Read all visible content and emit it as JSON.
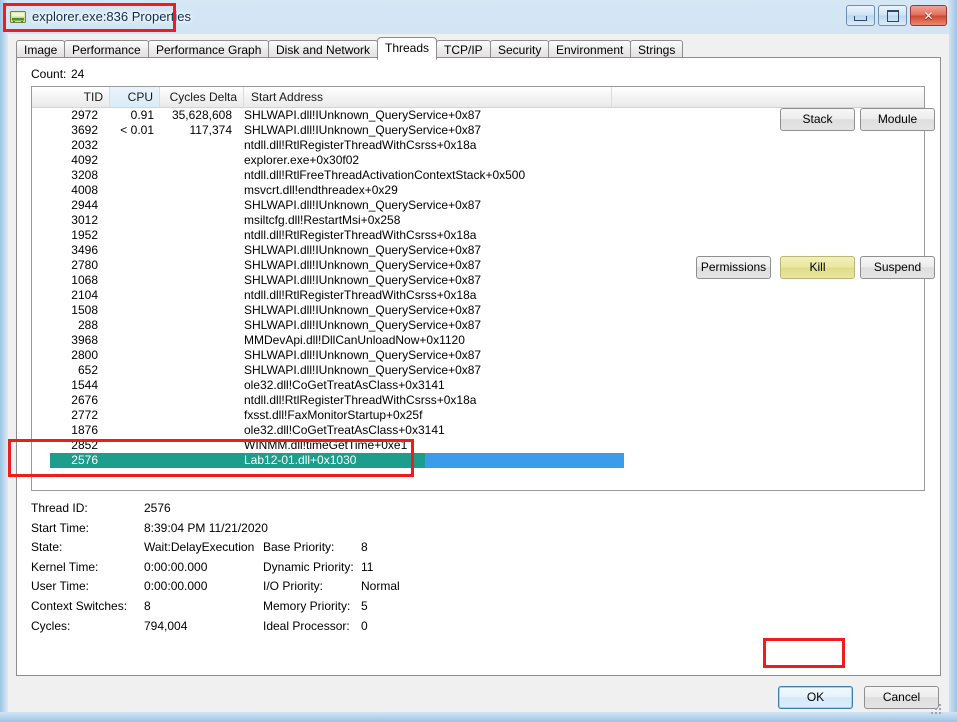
{
  "window": {
    "title": "explorer.exe:836 Properties",
    "icon": "process-explorer-icon",
    "minimize_label": "Minimize",
    "maximize_label": "Maximize",
    "close_label": "Close"
  },
  "tabs": [
    {
      "label": "Image",
      "active": false
    },
    {
      "label": "Performance",
      "active": false
    },
    {
      "label": "Performance Graph",
      "active": false
    },
    {
      "label": "Disk and Network",
      "active": false
    },
    {
      "label": "Threads",
      "active": true
    },
    {
      "label": "TCP/IP",
      "active": false
    },
    {
      "label": "Security",
      "active": false
    },
    {
      "label": "Environment",
      "active": false
    },
    {
      "label": "Strings",
      "active": false
    }
  ],
  "threads": {
    "count_label": "Count:",
    "count_value": "24",
    "columns": [
      {
        "key": "tid",
        "label": "TID",
        "sorted": false
      },
      {
        "key": "cpu",
        "label": "CPU",
        "sorted": true
      },
      {
        "key": "cyc",
        "label": "Cycles Delta",
        "sorted": false
      },
      {
        "key": "addr",
        "label": "Start Address",
        "sorted": false
      }
    ],
    "sort_direction": "descending",
    "rows": [
      {
        "tid": "2972",
        "cpu": "0.91",
        "cyc": "35,628,608",
        "addr": "SHLWAPI.dll!IUnknown_QueryService+0x87"
      },
      {
        "tid": "3692",
        "cpu": "< 0.01",
        "cyc": "117,374",
        "addr": "SHLWAPI.dll!IUnknown_QueryService+0x87"
      },
      {
        "tid": "2032",
        "cpu": "",
        "cyc": "",
        "addr": "ntdll.dll!RtlRegisterThreadWithCsrss+0x18a"
      },
      {
        "tid": "4092",
        "cpu": "",
        "cyc": "",
        "addr": "explorer.exe+0x30f02"
      },
      {
        "tid": "3208",
        "cpu": "",
        "cyc": "",
        "addr": "ntdll.dll!RtlFreeThreadActivationContextStack+0x500"
      },
      {
        "tid": "4008",
        "cpu": "",
        "cyc": "",
        "addr": "msvcrt.dll!endthreadex+0x29"
      },
      {
        "tid": "2944",
        "cpu": "",
        "cyc": "",
        "addr": "SHLWAPI.dll!IUnknown_QueryService+0x87"
      },
      {
        "tid": "3012",
        "cpu": "",
        "cyc": "",
        "addr": "msiltcfg.dll!RestartMsi+0x258"
      },
      {
        "tid": "1952",
        "cpu": "",
        "cyc": "",
        "addr": "ntdll.dll!RtlRegisterThreadWithCsrss+0x18a"
      },
      {
        "tid": "3496",
        "cpu": "",
        "cyc": "",
        "addr": "SHLWAPI.dll!IUnknown_QueryService+0x87"
      },
      {
        "tid": "2780",
        "cpu": "",
        "cyc": "",
        "addr": "SHLWAPI.dll!IUnknown_QueryService+0x87"
      },
      {
        "tid": "1068",
        "cpu": "",
        "cyc": "",
        "addr": "SHLWAPI.dll!IUnknown_QueryService+0x87"
      },
      {
        "tid": "2104",
        "cpu": "",
        "cyc": "",
        "addr": "ntdll.dll!RtlRegisterThreadWithCsrss+0x18a"
      },
      {
        "tid": "1508",
        "cpu": "",
        "cyc": "",
        "addr": "SHLWAPI.dll!IUnknown_QueryService+0x87"
      },
      {
        "tid": "288",
        "cpu": "",
        "cyc": "",
        "addr": "SHLWAPI.dll!IUnknown_QueryService+0x87"
      },
      {
        "tid": "3968",
        "cpu": "",
        "cyc": "",
        "addr": "MMDevApi.dll!DllCanUnloadNow+0x1120"
      },
      {
        "tid": "2800",
        "cpu": "",
        "cyc": "",
        "addr": "SHLWAPI.dll!IUnknown_QueryService+0x87"
      },
      {
        "tid": "652",
        "cpu": "",
        "cyc": "",
        "addr": "SHLWAPI.dll!IUnknown_QueryService+0x87"
      },
      {
        "tid": "1544",
        "cpu": "",
        "cyc": "",
        "addr": "ole32.dll!CoGetTreatAsClass+0x3141"
      },
      {
        "tid": "2676",
        "cpu": "",
        "cyc": "",
        "addr": "ntdll.dll!RtlRegisterThreadWithCsrss+0x18a"
      },
      {
        "tid": "2772",
        "cpu": "",
        "cyc": "",
        "addr": "fxsst.dll!FaxMonitorStartup+0x25f"
      },
      {
        "tid": "1876",
        "cpu": "",
        "cyc": "",
        "addr": "ole32.dll!CoGetTreatAsClass+0x3141"
      },
      {
        "tid": "2852",
        "cpu": "",
        "cyc": "",
        "addr": "WINMM.dll!timeGetTime+0xe1"
      },
      {
        "tid": "2576",
        "cpu": "",
        "cyc": "",
        "addr": "Lab12-01.dll+0x1030",
        "selected": true,
        "new_thread": true
      }
    ]
  },
  "detail": {
    "fields_left": [
      {
        "label": "Thread ID:",
        "value": "2576"
      },
      {
        "label": "Start Time:",
        "value": "8:39:04 PM   11/21/2020"
      },
      {
        "label": "State:",
        "value": "Wait:DelayExecution"
      },
      {
        "label": "Kernel Time:",
        "value": "0:00:00.000"
      },
      {
        "label": "User Time:",
        "value": "0:00:00.000"
      },
      {
        "label": "Context Switches:",
        "value": "8"
      },
      {
        "label": "Cycles:",
        "value": "794,004"
      }
    ],
    "fields_right": [
      {
        "label": "Base Priority:",
        "value": "8"
      },
      {
        "label": "Dynamic Priority:",
        "value": "11"
      },
      {
        "label": "I/O Priority:",
        "value": "Normal"
      },
      {
        "label": "Memory Priority:",
        "value": "5"
      },
      {
        "label": "Ideal Processor:",
        "value": "0"
      }
    ]
  },
  "buttons": {
    "stack": "Stack",
    "module": "Module",
    "permissions": "Permissions",
    "kill": "Kill",
    "suspend": "Suspend",
    "ok": "OK",
    "cancel": "Cancel"
  },
  "colors": {
    "annotation": "#ee1c1c",
    "new_thread_row": "#1d9e8c",
    "selection": "#3b9ceb",
    "kill_highlight": "#e9e79d",
    "title_bar": "#c6dcef"
  }
}
